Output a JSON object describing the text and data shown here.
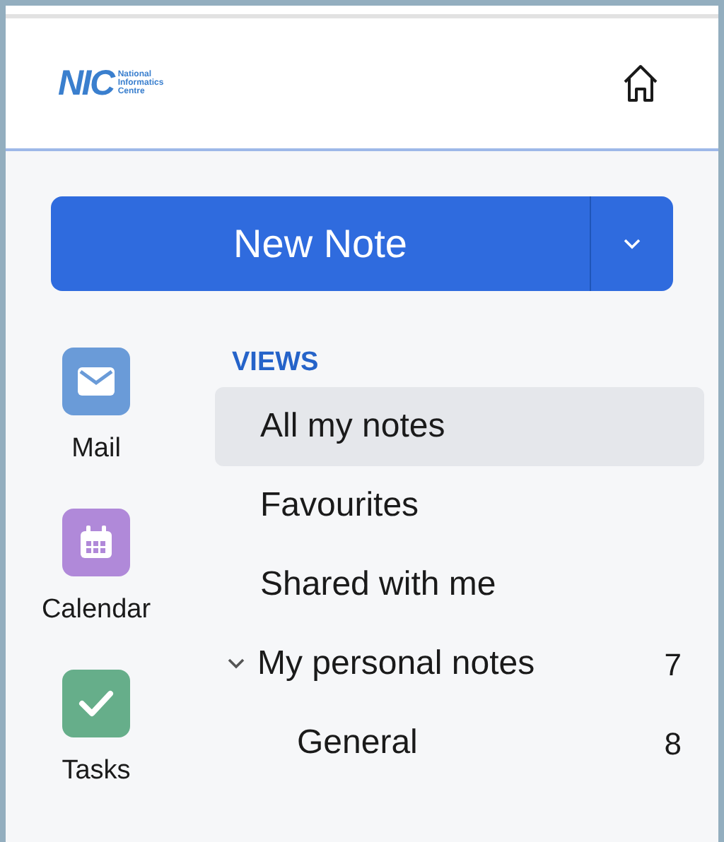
{
  "header": {
    "logo": {
      "mark": "NIC",
      "lines": [
        "National",
        "Informatics",
        "Centre"
      ]
    }
  },
  "new_note": {
    "label": "New Note"
  },
  "apps": [
    {
      "label": "Mail",
      "kind": "mail",
      "color": "#6a9bd8"
    },
    {
      "label": "Calendar",
      "kind": "calendar",
      "color": "#b089d9"
    },
    {
      "label": "Tasks",
      "kind": "tasks",
      "color": "#66ae8a"
    }
  ],
  "views": {
    "heading": "VIEWS",
    "items": [
      {
        "label": "All my notes",
        "selected": true
      },
      {
        "label": "Favourites",
        "selected": false
      },
      {
        "label": "Shared with me",
        "selected": false
      },
      {
        "label": "My personal notes",
        "selected": false,
        "count": "7",
        "expanded": true,
        "children": [
          {
            "label": "General",
            "selected": false,
            "count": "8"
          }
        ]
      }
    ]
  }
}
